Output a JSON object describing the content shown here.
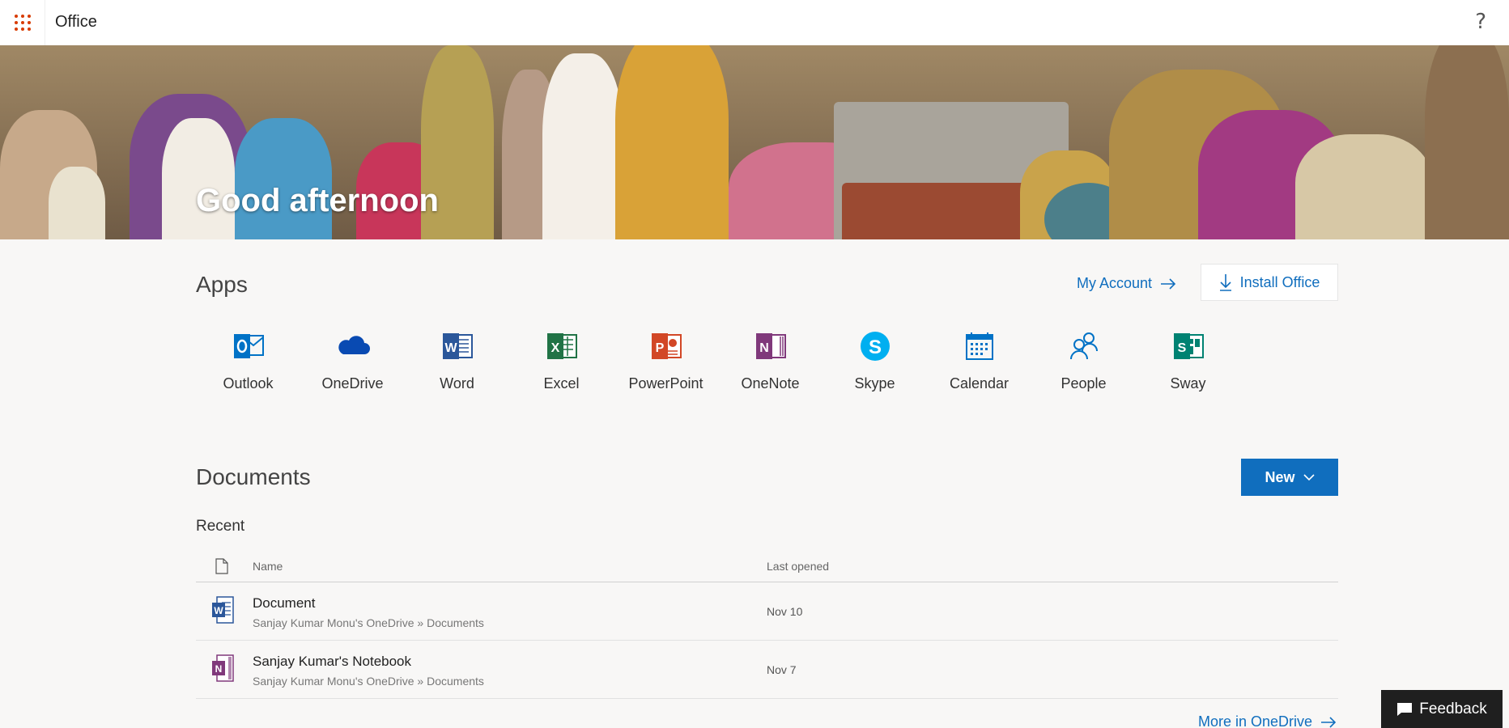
{
  "header": {
    "brand": "Office",
    "help_icon": "help-question-icon",
    "waffle_icon": "app-launcher-icon"
  },
  "hero": {
    "greeting": "Good afternoon"
  },
  "apps": {
    "title": "Apps",
    "my_account": "My Account",
    "install_office": "Install Office",
    "items": [
      {
        "label": "Outlook",
        "icon": "outlook-icon",
        "color": "#0072c6"
      },
      {
        "label": "OneDrive",
        "icon": "onedrive-icon",
        "color": "#094ab2"
      },
      {
        "label": "Word",
        "icon": "word-icon",
        "color": "#2b579a"
      },
      {
        "label": "Excel",
        "icon": "excel-icon",
        "color": "#217346"
      },
      {
        "label": "PowerPoint",
        "icon": "powerpoint-icon",
        "color": "#d24726"
      },
      {
        "label": "OneNote",
        "icon": "onenote-icon",
        "color": "#80397b"
      },
      {
        "label": "Skype",
        "icon": "skype-icon",
        "color": "#00aff0"
      },
      {
        "label": "Calendar",
        "icon": "calendar-icon",
        "color": "#0072c6"
      },
      {
        "label": "People",
        "icon": "people-icon",
        "color": "#0072c6"
      },
      {
        "label": "Sway",
        "icon": "sway-icon",
        "color": "#008272"
      }
    ]
  },
  "documents": {
    "title": "Documents",
    "new_button": "New",
    "recent": "Recent",
    "columns": {
      "name": "Name",
      "last_opened": "Last opened"
    },
    "rows": [
      {
        "name": "Document",
        "path": "Sanjay Kumar Monu's OneDrive » Documents",
        "last_opened": "Nov 10",
        "icon": "word-doc-icon"
      },
      {
        "name": "Sanjay Kumar's Notebook",
        "path": "Sanjay Kumar Monu's OneDrive » Documents",
        "last_opened": "Nov 7",
        "icon": "onenote-doc-icon"
      }
    ],
    "more_link": "More in OneDrive"
  },
  "feedback": {
    "label": "Feedback"
  },
  "colors": {
    "accent": "#106ebe",
    "waffle": "#d83b01"
  }
}
